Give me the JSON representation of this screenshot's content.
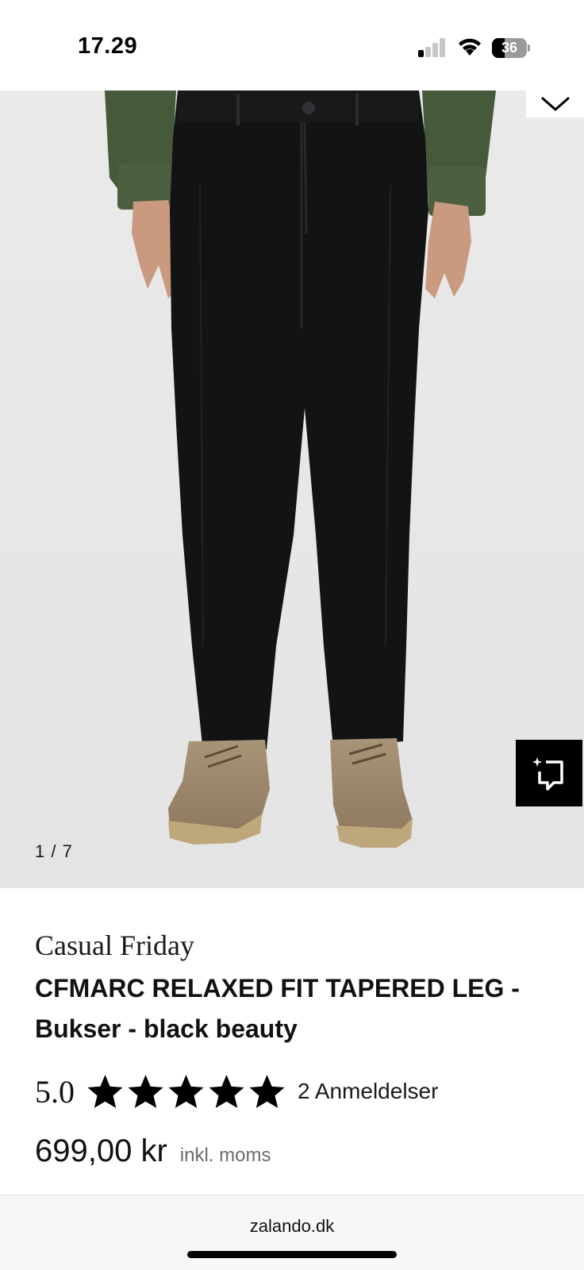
{
  "status_bar": {
    "time": "17.29",
    "battery_level": "36",
    "signal_bars_active": 1,
    "signal_bars_total": 4,
    "icons": [
      "cellular-signal-icon",
      "wifi-icon",
      "battery-icon"
    ]
  },
  "gallery": {
    "counter": "1 / 7",
    "current_image": 1,
    "total_images": 7,
    "background_color": "#ebeceb",
    "icons": [
      "chevron-down-icon",
      "virtual-try-on-icon"
    ]
  },
  "product": {
    "brand": "Casual Friday",
    "title": "CFMARC RELAXED FIT TAPERED LEG - Bukser - black beauty",
    "rating_value": "5.0",
    "rating_stars": 5,
    "review_count": "2 Anmeldelser",
    "price": "699,00 kr",
    "tax_note": "inkl. moms"
  },
  "browser": {
    "url": "zalando.dk"
  },
  "colors": {
    "text_primary": "#111111",
    "text_secondary": "#6b6b6b",
    "accent": "#000000"
  }
}
